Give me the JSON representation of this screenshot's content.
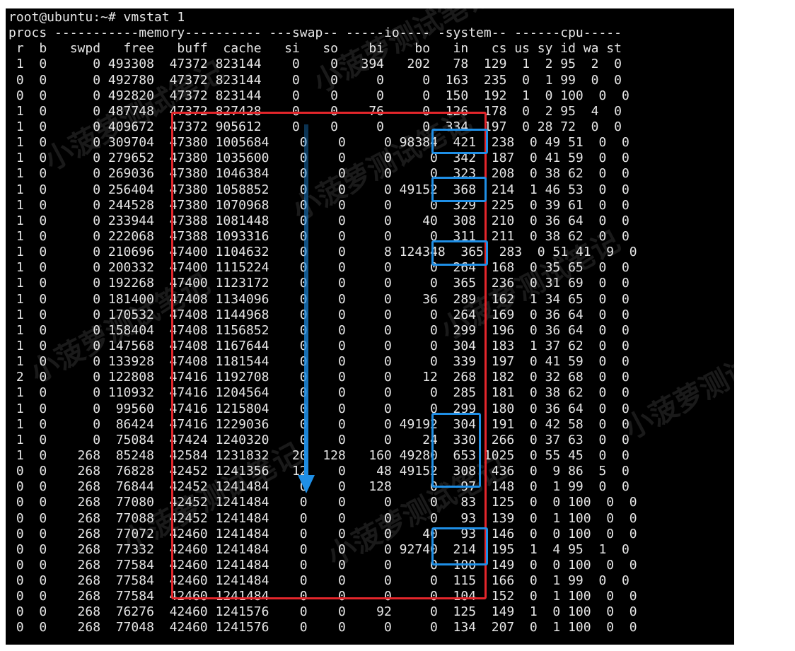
{
  "terminal": {
    "lines": [
      "root@ubuntu:~# vmstat 1",
      "procs -----------memory---------- ---swap-- -----io---- -system-- ------cpu-----",
      " r  b   swpd   free   buff  cache   si   so    bi    bo   in   cs us sy id wa st",
      " 1  0      0 493308  47372 823144    0    0   394   202   78  129  1  2 95  2  0",
      " 0  0      0 492780  47372 823144    0    0     0     0  163  235  0  1 99  0  0",
      " 0  0      0 492820  47372 823144    0    0     0     0  150  192  1  0 100  0  0",
      " 1  0      0 487748  47372 827428    0    0    76     0  126  178  0  2 95  4  0",
      " 1  0      0 409672  47372 905612    0    0     0     0  334  197  0 28 72  0  0",
      " 1  0      0 309704  47380 1005684    0    0     0 98384  421  238  0 49 51  0  0",
      " 1  0      0 279652  47380 1035600    0    0     0     0  342  187  0 41 59  0  0",
      " 1  0      0 269036  47380 1046384    0    0     0     0  323  208  0 38 62  0  0",
      " 1  0      0 256404  47380 1058852    0    0     0 49152  368  214  1 46 53  0  0",
      " 1  0      0 244528  47380 1070968    0    0     0     0  329  225  0 39 61  0  0",
      " 1  0      0 233944  47388 1081448    0    0     0    40  308  210  0 36 64  0  0",
      " 1  0      0 222068  47388 1093316    0    0     0     0  311  211  0 38 62  0  0",
      " 1  0      0 210696  47400 1104632    0    0     8 124348  365  283  0 51 41  9  0",
      " 1  0      0 200332  47400 1115224    0    0     0     0  264  168  0 35 65  0  0",
      " 1  0      0 192268  47400 1123172    0    0     0     0  365  236  0 31 69  0  0",
      " 1  0      0 181400  47408 1134096    0    0     0    36  289  162  1 34 65  0  0",
      " 1  0      0 170532  47408 1144968    0    0     0     0  264  169  0 36 64  0  0",
      " 1  0      0 158404  47408 1156852    0    0     0     0  299  196  0 36 64  0  0",
      " 1  0      0 147568  47408 1167644    0    0     0     0  304  183  1 37 62  0  0",
      " 1  0      0 133928  47408 1181544    0    0     0     0  339  197  0 41 59  0  0",
      " 2  0      0 122808  47416 1192708    0    0     0    12  268  182  0 32 68  0  0",
      " 1  0      0 110932  47416 1204564    0    0     0     0  285  181  0 38 62  0  0",
      " 1  0      0  99560  47416 1215804    0    0     0     0  299  180  0 36 64  0  0",
      " 1  0      0  86424  47416 1229036    0    0     0 49192  304  191  0 42 58  0  0",
      " 1  0      0  75084  47424 1240320    0    0     0    24  330  266  0 37 63  0  0",
      " 1  0    268  85248  42584 1231832   20  128   160 49280  653 1025  0 55 45  0  0",
      " 0  0    268  76828  42452 1241356   12    0    48 49152  308  436  0  9 86  5  0",
      " 0  0    268  76844  42452 1241484    0    0   128     0   97  148  0  1 99  0  0",
      " 0  0    268  77080  42452 1241484    0    0     0     0   83  125  0  0 100  0  0",
      " 0  0    268  77088  42452 1241484    0    0     0     0   93  139  0  1 100  0  0",
      " 0  0    268  77072  42460 1241484    0    0     0    40   93  146  0  0 100  0  0",
      " 0  0    268  77332  42460 1241484    0    0     0 92740  214  195  1  4 95  1  0",
      " 0  0    268  77584  42460 1241484    0    0     0     0  100  149  0  0 100  0  0",
      " 0  0    268  77584  42460 1241484    0    0     0     0  115  166  0  1 99  0  0",
      " 0  0    268  77584  42460 1241484    0    0     0     0  104  152  0  1 100  0  0",
      " 0  0    268  76276  42460 1241576    0    0    92     0  125  149  1  0 100  0  0",
      " 0  0    268  77048  42460 1241576    0    0     0     0  134  207  0  1 100  0  0"
    ]
  },
  "watermark": {
    "text": "小菠萝测试笔记"
  },
  "annotations": {
    "red_box_color": "#e4262b",
    "blue_box_color": "#1f8fe6",
    "arrow_color": "#1f8fe6"
  }
}
